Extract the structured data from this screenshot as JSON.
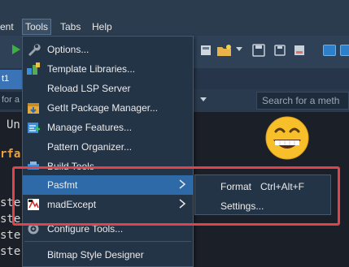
{
  "menubar": {
    "items": [
      {
        "label": "ent"
      },
      {
        "label": "Tools"
      },
      {
        "label": "Tabs"
      },
      {
        "label": "Help"
      }
    ]
  },
  "editor": {
    "tab_label": "t1",
    "search_left_placeholder": "for a",
    "search_right_placeholder": "Search for a meth",
    "code_lines": [
      "Un",
      "rfa",
      "ste",
      "ste",
      "ste",
      "ste"
    ]
  },
  "tools_menu": {
    "items": [
      {
        "label": "Options...",
        "icon": "wrench-icon"
      },
      {
        "label": "Template Libraries...",
        "icon": "template-libraries-icon"
      },
      {
        "label": "Reload LSP Server",
        "icon": ""
      },
      {
        "label": "GetIt Package Manager...",
        "icon": "getit-package-icon"
      },
      {
        "label": "Manage Features...",
        "icon": "manage-features-icon"
      },
      {
        "label": "Pattern Organizer...",
        "icon": ""
      },
      {
        "label": "Build Tools",
        "icon": "build-tools-icon"
      },
      {
        "label": "Pasfmt",
        "icon": "",
        "has_submenu": true
      },
      {
        "label": "madExcept",
        "icon": "madexcept-icon",
        "has_submenu": true
      },
      {
        "label": "Configure Tools...",
        "icon": "configure-tools-icon"
      },
      {
        "label": "Bitmap Style Designer",
        "icon": ""
      }
    ]
  },
  "pasfmt_submenu": {
    "items": [
      {
        "label": "Format",
        "shortcut": "Ctrl+Alt+F"
      },
      {
        "label": "Settings...",
        "shortcut": ""
      }
    ]
  },
  "colors": {
    "menu_bg": "#243447",
    "highlight": "#2f6aa8",
    "annotation_box": "#e0444a"
  },
  "annotation": {
    "icon": "grinning-face-emoji-icon"
  }
}
